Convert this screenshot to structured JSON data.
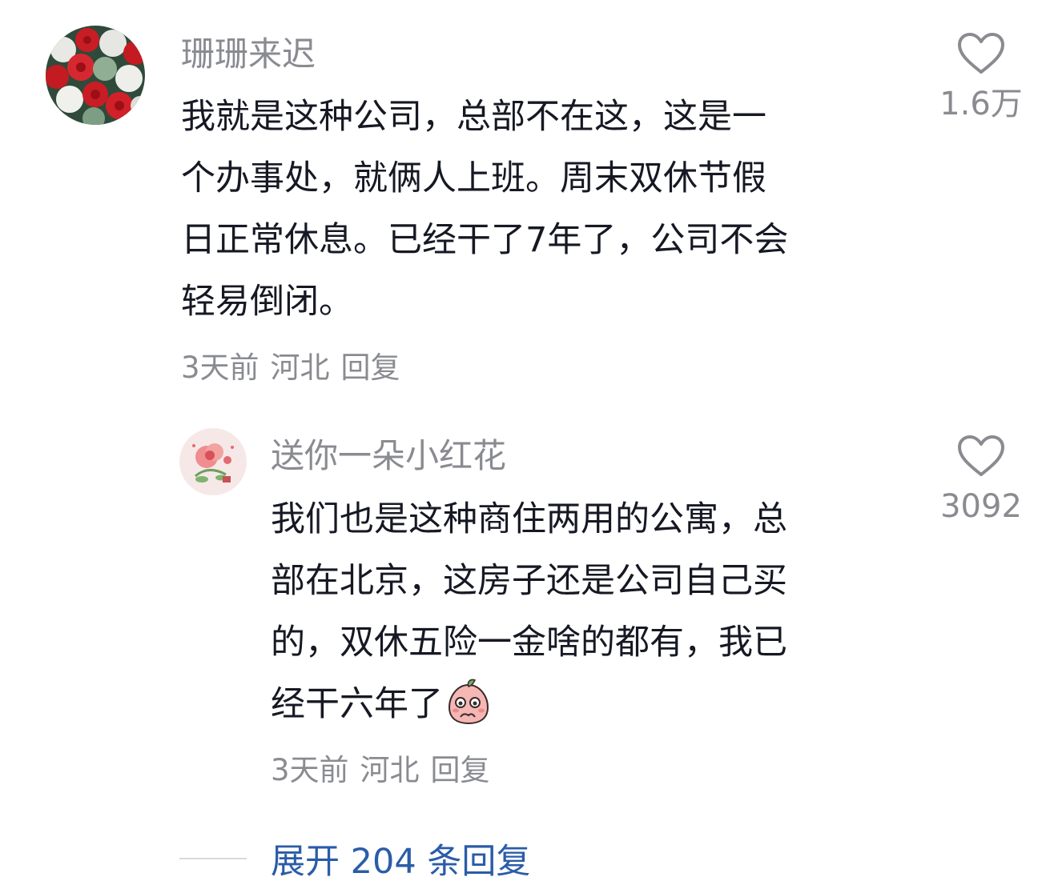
{
  "comments": [
    {
      "username": "珊珊来迟",
      "lines": [
        "我就是这种公司，总部不在这，这是一",
        "个办事处，就俩人上班。周末双休节假",
        "日正常休息。已经干了7年了，公司不会",
        "轻易倒闭。"
      ],
      "time": "3天前",
      "location": "河北",
      "reply_label": "回复",
      "like_count": "1.6万",
      "avatar_icon": "rose-bouquet-avatar"
    },
    {
      "username": "送你一朵小红花",
      "lines": [
        "我们也是这种商住两用的公寓，总",
        "部在北京，这房子还是公司自己买",
        "的，双休五险一金啥的都有，我已",
        "经干六年了"
      ],
      "emoji": "shy-peach-emoji",
      "time": "3天前",
      "location": "河北",
      "reply_label": "回复",
      "like_count": "3092",
      "avatar_icon": "flower-illustration-avatar"
    }
  ],
  "expand_label": "展开 204 条回复",
  "colors": {
    "text": "#161823",
    "secondary": "#8a8b91",
    "link": "#2a5ca8"
  }
}
